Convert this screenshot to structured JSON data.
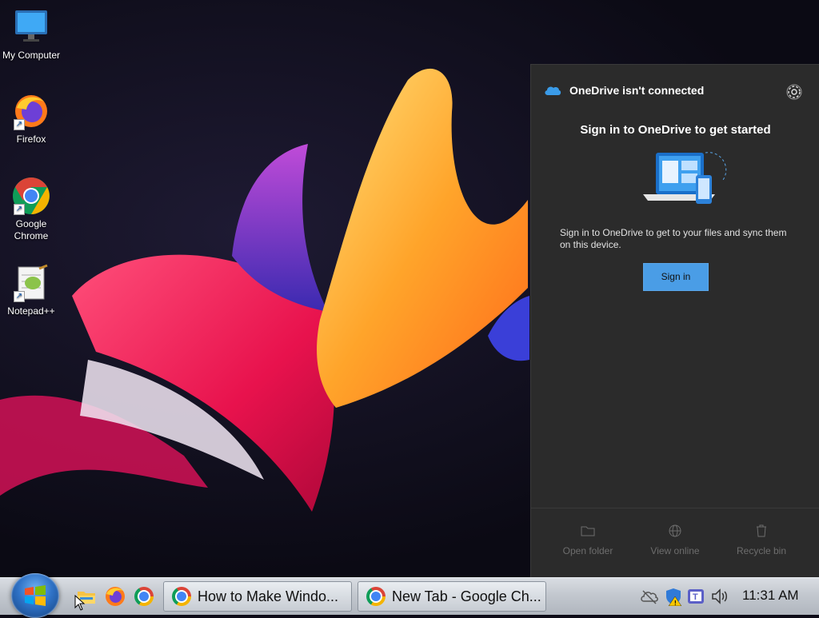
{
  "desktop": {
    "icons": [
      {
        "label": "My Computer",
        "icon": "monitor-icon"
      },
      {
        "label": "Firefox",
        "icon": "firefox-icon"
      },
      {
        "label": "Google Chrome",
        "icon": "chrome-icon"
      },
      {
        "label": "Notepad++",
        "icon": "notepadpp-icon"
      }
    ]
  },
  "onedrive": {
    "header": "OneDrive isn't connected",
    "title": "Sign in to OneDrive to get started",
    "description": "Sign in to OneDrive to get to your files and sync them on this device.",
    "signin_label": "Sign in",
    "footer": [
      {
        "label": "Open folder",
        "icon": "folder-icon"
      },
      {
        "label": "View online",
        "icon": "globe-icon"
      },
      {
        "label": "Recycle bin",
        "icon": "trash-icon"
      }
    ],
    "colors": {
      "panel": "#2b2b2b",
      "accent": "#4a9de6"
    }
  },
  "taskbar": {
    "pinned": [
      "file-explorer-icon",
      "firefox-icon",
      "chrome-icon"
    ],
    "windows": [
      {
        "title": "How to Make Windo...",
        "icon": "chrome-icon"
      },
      {
        "title": "New Tab - Google Ch...",
        "icon": "chrome-icon"
      }
    ],
    "tray": [
      "onedrive-offline-icon",
      "security-warning-icon",
      "teams-icon",
      "volume-icon"
    ],
    "clock": "11:31 AM"
  }
}
